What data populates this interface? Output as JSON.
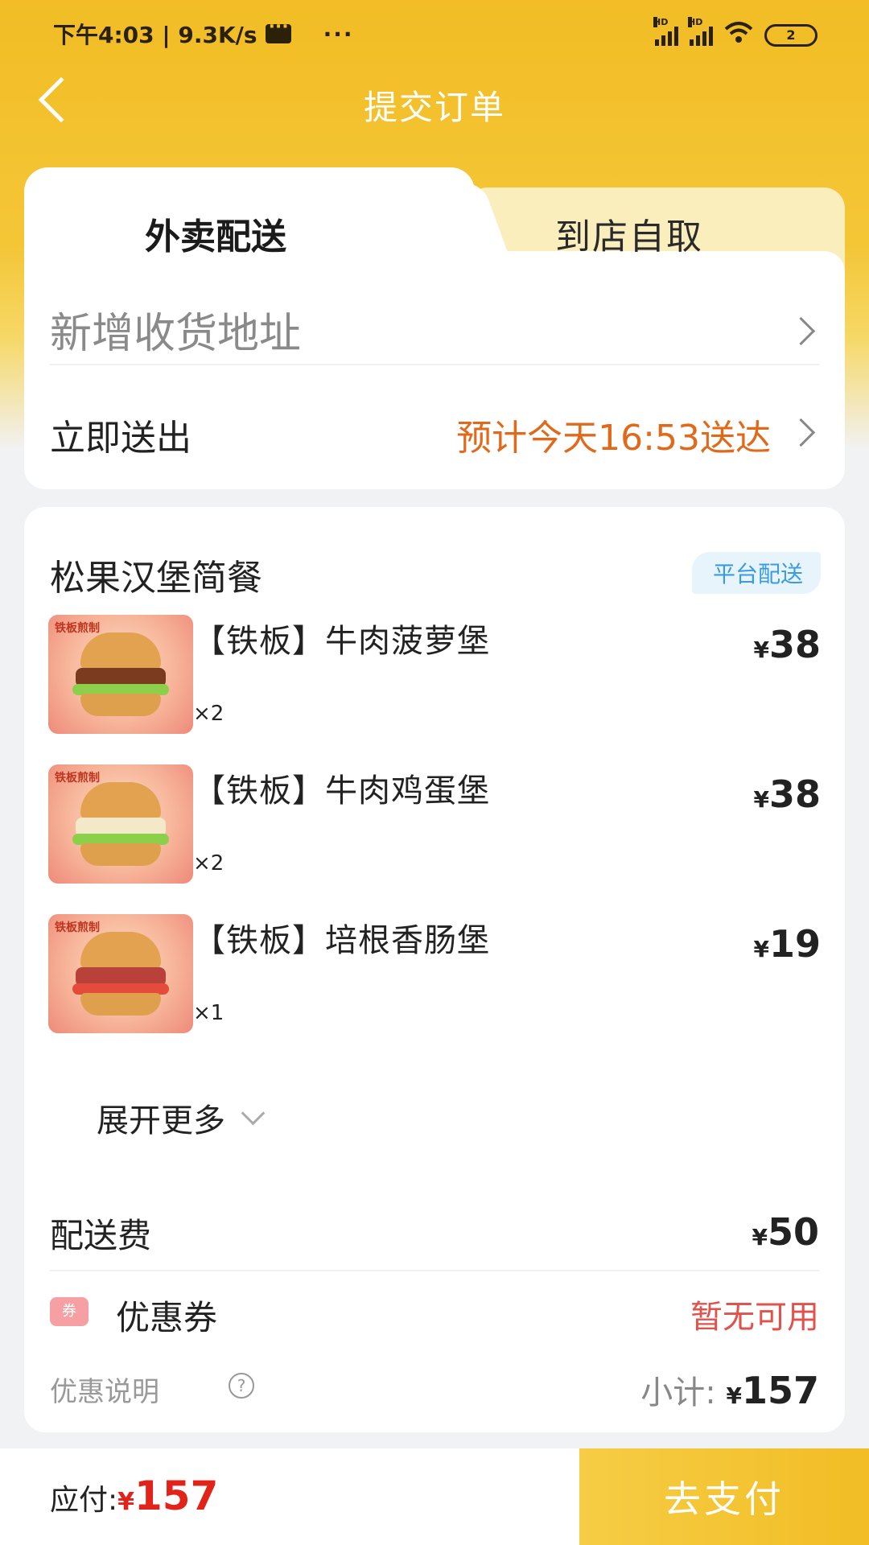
{
  "status_bar": {
    "time_speed": "下午4:03 | 9.3K/s",
    "dots": "···",
    "signal_label": "HD",
    "battery": "2"
  },
  "header": {
    "title": "提交订单"
  },
  "tabs": [
    {
      "label": "外卖配送",
      "active": true
    },
    {
      "label": "到店自取",
      "active": false
    }
  ],
  "address": {
    "placeholder": "新增收货地址",
    "delivery_option": "立即送出",
    "eta": "预计今天16:53送达"
  },
  "order": {
    "shop_name": "松果汉堡简餐",
    "badge": "平台配送",
    "currency": "¥",
    "items": [
      {
        "name": "【铁板】牛肉菠萝堡",
        "qty": "×2",
        "price": "38",
        "image_tag": "铁板煎制",
        "image": "burger-image"
      },
      {
        "name": "【铁板】牛肉鸡蛋堡",
        "qty": "×2",
        "price": "38",
        "image_tag": "铁板煎制",
        "image": "burger-image"
      },
      {
        "name": "【铁板】培根香肠堡",
        "qty": "×1",
        "price": "19",
        "image_tag": "铁板煎制",
        "image": "burger-image"
      }
    ],
    "expand_label": "展开更多",
    "delivery_fee_label": "配送费",
    "delivery_fee": "50",
    "coupon_icon": "券",
    "coupon_label": "优惠券",
    "coupon_value": "暂无可用",
    "explain_label": "优惠说明",
    "help_icon": "?",
    "subtotal_label": "小计:",
    "subtotal": "157"
  },
  "bottom": {
    "payable_label": "应付:",
    "payable_amount": "157",
    "pay_button": "去支付"
  },
  "colors": {
    "brand_yellow": "#f2bd25",
    "eta_orange": "#e06a1b",
    "price_red": "#e2231a",
    "badge_blue": "#3a9be0"
  }
}
